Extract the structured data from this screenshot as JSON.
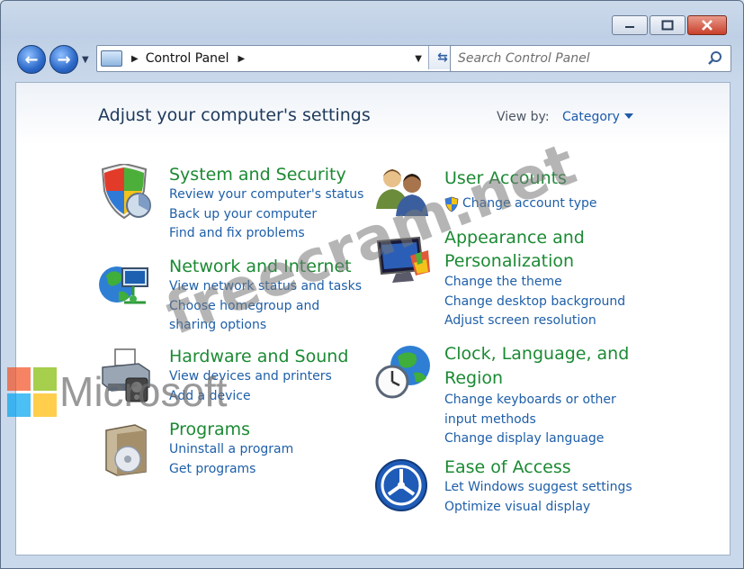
{
  "window": {
    "controls": [
      "minimize-icon",
      "maximize-icon",
      "close-icon"
    ]
  },
  "nav": {
    "address": {
      "breadcrumb": "Control Panel"
    },
    "search": {
      "placeholder": "Search Control Panel"
    }
  },
  "main": {
    "heading": "Adjust your computer's settings",
    "view_by_label": "View by:",
    "view_by_value": "Category",
    "categories": [
      {
        "title": "System and Security",
        "icon": "shield-icon",
        "links": [
          "Review your computer's status",
          "Back up your computer",
          "Find and fix problems"
        ]
      },
      {
        "title": "Network and Internet",
        "icon": "network-globe-icon",
        "links": [
          "View network status and tasks",
          "Choose homegroup and",
          "sharing options"
        ]
      },
      {
        "title": "Hardware and Sound",
        "icon": "printer-icon",
        "links": [
          "View devices and printers",
          "Add a device"
        ]
      },
      {
        "title": "Programs",
        "icon": "programs-box-icon",
        "links": [
          "Uninstall a program",
          "Get programs"
        ]
      },
      {
        "title": "User Accounts",
        "icon": "users-icon",
        "links": [
          "Change account type"
        ]
      },
      {
        "title_lines": [
          "Appearance and",
          "Personalization"
        ],
        "icon": "appearance-monitor-icon",
        "links": [
          "Change the theme",
          "Change desktop background",
          "Adjust screen resolution"
        ]
      },
      {
        "title_lines": [
          "Clock, Language, and",
          "Region"
        ],
        "icon": "clock-globe-icon",
        "links": [
          "Change keyboards or other",
          "input methods",
          "Change display language"
        ]
      },
      {
        "title": "Ease of Access",
        "icon": "ease-of-access-icon",
        "links": [
          "Let Windows suggest settings",
          "Optimize visual display"
        ]
      }
    ]
  },
  "overlay": {
    "watermark": "freecram.net",
    "ms_logo_text": "Microsoft",
    "ms_logo_colors": [
      "#f25022",
      "#7fba00",
      "#00a4ef",
      "#ffb900"
    ]
  }
}
